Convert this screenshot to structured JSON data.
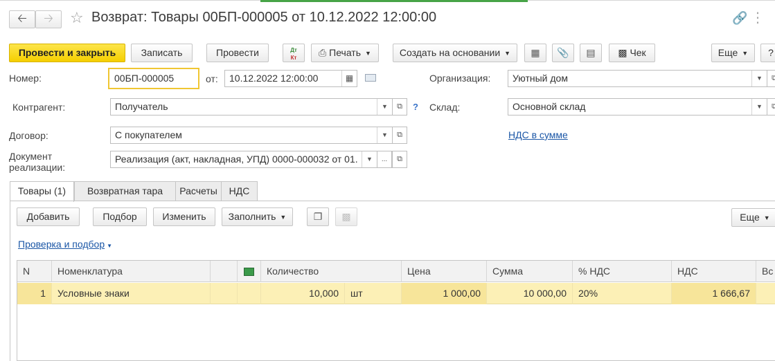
{
  "window": {
    "title": "Возврат: Товары 00БП-000005 от 10.12.2022 12:00:00"
  },
  "toolbar": {
    "post_close": "Провести и закрыть",
    "save": "Записать",
    "post": "Провести",
    "dt_kt_top": "Дт",
    "dt_kt_bottom": "Кт",
    "print": "Печать",
    "create_based": "Создать на основании",
    "check": "Чек",
    "more": "Еще",
    "help": "?"
  },
  "form": {
    "number_label": "Номер:",
    "number_value": "00БП-000005",
    "date_label": "от:",
    "date_value": "10.12.2022 12:00:00",
    "org_label": "Организация:",
    "org_value": "Уютный дом",
    "counterparty_label": "Контрагент:",
    "counterparty_value": "Получатель",
    "warehouse_label": "Склад:",
    "warehouse_value": "Основной склад",
    "contract_label": "Договор:",
    "contract_value": "С покупателем",
    "vat_link": "НДС в сумме",
    "sale_doc_label_1": "Документ",
    "sale_doc_label_2": "реализации:",
    "sale_doc_value": "Реализация (акт, накладная, УПД) 0000-000032 от 01.",
    "help_q": "?",
    "ellipsis": "..."
  },
  "tabs": [
    {
      "label": "Товары (1)",
      "active": true
    },
    {
      "label": "Возвратная тара",
      "active": false
    },
    {
      "label": "Расчеты",
      "active": false
    },
    {
      "label": "НДС",
      "active": false
    }
  ],
  "goods_toolbar": {
    "add": "Добавить",
    "pick": "Подбор",
    "edit": "Изменить",
    "fill": "Заполнить",
    "more": "Еще",
    "check_link": "Проверка и подбор"
  },
  "table": {
    "headers": [
      "N",
      "Номенклатура",
      "",
      "",
      "Количество",
      "Цена",
      "Сумма",
      "% НДС",
      "НДС",
      "Вс"
    ],
    "rows": [
      {
        "n": "1",
        "item": "Условные знаки",
        "qty": "10,000",
        "unit": "шт",
        "price": "1 000,00",
        "sum": "10 000,00",
        "vat_rate": "20%",
        "vat": "1 666,67"
      }
    ]
  },
  "colors": {
    "primary_button": "#f5cf00",
    "selected_row": "#fcf0b6",
    "link": "#1a56a6",
    "focus_border": "#f0c632"
  }
}
